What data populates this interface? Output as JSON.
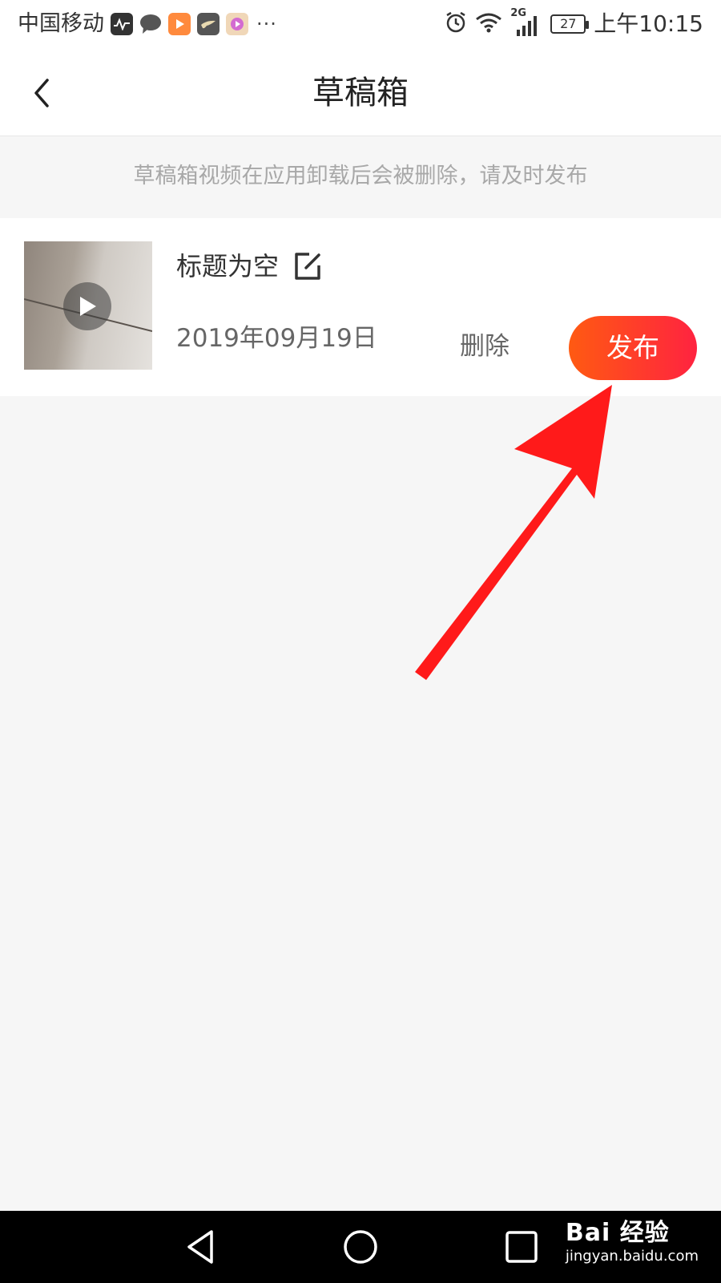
{
  "status_bar": {
    "carrier": "中国移动",
    "more": "···",
    "network": "2G",
    "battery": "27",
    "time": "上午10:15"
  },
  "nav": {
    "title": "草稿箱"
  },
  "tip": "草稿箱视频在应用卸载后会被删除，请及时发布",
  "draft": {
    "title": "标题为空",
    "date": "2019年09月19日",
    "delete_label": "删除",
    "publish_label": "发布"
  },
  "watermark": {
    "brand": "Bai 经验",
    "url": "jingyan.baidu.com"
  },
  "colors": {
    "publish_start": "#ff5a12",
    "publish_end": "#ff2340",
    "annotation_arrow": "#ff1a1a"
  }
}
